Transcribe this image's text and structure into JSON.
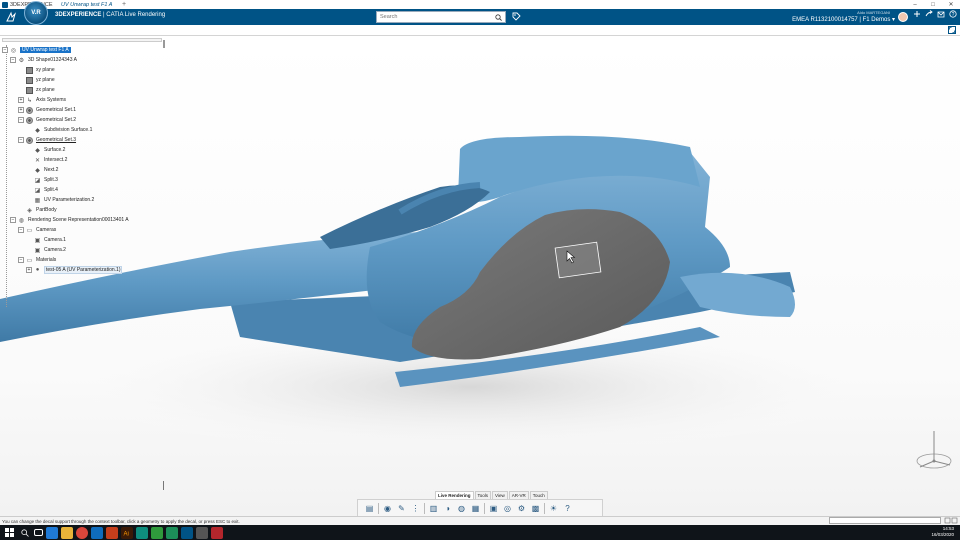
{
  "window": {
    "title": "3DEXPERIENCE",
    "controls": [
      "–",
      "□",
      "✕"
    ]
  },
  "topbar": {
    "brand_bold": "3DEXPERIENCE",
    "brand_rest": " | CATIA  Live Rendering",
    "compass_label": "V.R",
    "search_placeholder": "Search",
    "user_name": "Aldo MARTEGANI",
    "context": "EMEA R1132100014757 | F1 Demos ▾",
    "icons": [
      "share-icon",
      "add-icon",
      "forward-icon",
      "help-icon"
    ]
  },
  "tabbar": {
    "active_tab": "UV Unwrap test F1 A",
    "add_label": "+"
  },
  "tree": {
    "items": [
      {
        "label": "UV Unwrap test F1 A",
        "depth": 0,
        "icon": "product",
        "expander": "-",
        "selected": true
      },
      {
        "label": "3D Shape01324343 A",
        "depth": 1,
        "icon": "part",
        "expander": "-"
      },
      {
        "label": "xy plane",
        "depth": 2,
        "icon": "plane"
      },
      {
        "label": "yz plane",
        "depth": 2,
        "icon": "plane"
      },
      {
        "label": "zx plane",
        "depth": 2,
        "icon": "plane"
      },
      {
        "label": "Axis Systems",
        "depth": 2,
        "icon": "axis",
        "expander": "+"
      },
      {
        "label": "Geometrical Set.1",
        "depth": 2,
        "icon": "geoset",
        "expander": "+"
      },
      {
        "label": "Geometrical Set.2",
        "depth": 2,
        "icon": "geoset",
        "expander": "-"
      },
      {
        "label": "Subdivision Surface.1",
        "depth": 3,
        "icon": "surface"
      },
      {
        "label": "Geometrical Set.3",
        "depth": 2,
        "icon": "geoset",
        "expander": "-",
        "underline": true
      },
      {
        "label": "Surface.2",
        "depth": 3,
        "icon": "surface"
      },
      {
        "label": "Intersect.2",
        "depth": 3,
        "icon": "intersect"
      },
      {
        "label": "Next.2",
        "depth": 3,
        "icon": "surface"
      },
      {
        "label": "Split.3",
        "depth": 3,
        "icon": "split"
      },
      {
        "label": "Split.4",
        "depth": 3,
        "icon": "split"
      },
      {
        "label": "UV Parameterization.2",
        "depth": 3,
        "icon": "uv"
      },
      {
        "label": "PartBody",
        "depth": 2,
        "icon": "body"
      },
      {
        "label": "Rendering Scene Representation00013401 A",
        "depth": 1,
        "icon": "scene",
        "expander": "-"
      },
      {
        "label": "Cameras",
        "depth": 2,
        "icon": "folder",
        "expander": "-"
      },
      {
        "label": "Camera.1",
        "depth": 3,
        "icon": "camera"
      },
      {
        "label": "Camera.2",
        "depth": 3,
        "icon": "camera"
      },
      {
        "label": "Materials",
        "depth": 2,
        "icon": "folder",
        "expander": "-"
      },
      {
        "label": "test-05 A (UV Parameterization.1)",
        "depth": 3,
        "icon": "material",
        "expander": "+",
        "highlight": true
      }
    ]
  },
  "action_bar": {
    "tabs": [
      "Live Rendering",
      "Tools",
      "View",
      "AR-VR",
      "Touch"
    ],
    "active_tab": "Live Rendering",
    "tools": [
      "render-icon",
      "sphere-icon",
      "decal-icon",
      "dots-icon",
      "layer-icon",
      "color-icon",
      "environment-icon",
      "material-icon",
      "camera-icon",
      "globe-icon",
      "settings-icon",
      "scene-icon",
      "light-icon",
      "help-icon"
    ]
  },
  "status": {
    "message": "You can change the decal support through the context toolbar, click a geometry to apply the decal, or press ESC to exit."
  },
  "taskbar": {
    "time": "14:53",
    "date": "16/03/2020"
  },
  "colors": {
    "brand_blue": "#005386",
    "body_blue": "#5f9ac5",
    "decal_gray": "#6b6b6b"
  }
}
